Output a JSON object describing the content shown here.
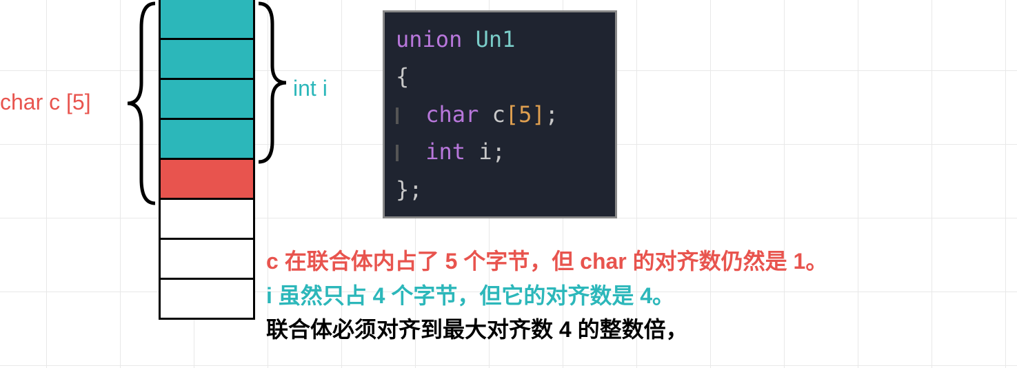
{
  "labels": {
    "char_c": "char c [5]",
    "int_i": "int i"
  },
  "code": {
    "kw_union": "union",
    "name": "Un1",
    "brace_open": "{",
    "type_char": "char",
    "var_c": "c",
    "arr_open": "[",
    "arr_size": "5",
    "arr_close": "]",
    "semi": ";",
    "type_int": "int",
    "var_i": "i",
    "brace_close": "}",
    "end_semi": ";"
  },
  "explain": {
    "line1": "c 在联合体内占了 5 个字节，但 char 的对齐数仍然是 1。",
    "line2": "i 虽然只占 4 个字节，但它的对齐数是 4。",
    "line3": "联合体必须对齐到最大对齐数 4 的整数倍，"
  },
  "chart_data": {
    "type": "table",
    "description": "union Un1 memory layout, 8 bytes total",
    "cells": [
      {
        "index": 0,
        "color": "teal",
        "used_by": [
          "char c[5]",
          "int i"
        ]
      },
      {
        "index": 1,
        "color": "teal",
        "used_by": [
          "char c[5]",
          "int i"
        ]
      },
      {
        "index": 2,
        "color": "teal",
        "used_by": [
          "char c[5]",
          "int i"
        ]
      },
      {
        "index": 3,
        "color": "teal",
        "used_by": [
          "char c[5]",
          "int i"
        ]
      },
      {
        "index": 4,
        "color": "red",
        "used_by": [
          "char c[5]"
        ]
      },
      {
        "index": 5,
        "color": "white",
        "used_by": [
          "padding"
        ]
      },
      {
        "index": 6,
        "color": "white",
        "used_by": [
          "padding"
        ]
      },
      {
        "index": 7,
        "color": "white",
        "used_by": [
          "padding"
        ]
      }
    ],
    "char_c_bytes": 5,
    "char_alignment": 1,
    "int_i_bytes": 4,
    "int_alignment": 4,
    "total_size": 8
  }
}
